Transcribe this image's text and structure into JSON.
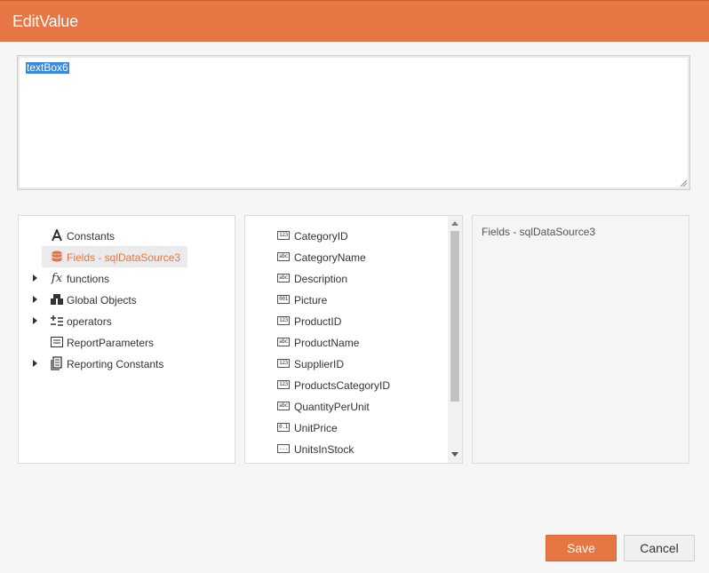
{
  "dialog": {
    "title": "EditValue"
  },
  "editor": {
    "value": "textBox6"
  },
  "tree": {
    "items": [
      {
        "label": "Constants",
        "icon": "letter-a-icon",
        "expandable": false,
        "selected": false
      },
      {
        "label": "Fields - sqlDataSource3",
        "icon": "database-icon",
        "expandable": false,
        "selected": true
      },
      {
        "label": "functions",
        "icon": "function-fx-icon",
        "expandable": true,
        "selected": false
      },
      {
        "label": "Global Objects",
        "icon": "objects-icon",
        "expandable": true,
        "selected": false
      },
      {
        "label": "operators",
        "icon": "operators-icon",
        "expandable": true,
        "selected": false
      },
      {
        "label": "ReportParameters",
        "icon": "parameters-icon",
        "expandable": false,
        "selected": false
      },
      {
        "label": "Reporting Constants",
        "icon": "document-icon",
        "expandable": true,
        "selected": false
      }
    ]
  },
  "fields": [
    {
      "label": "CategoryID",
      "type_glyph": "123"
    },
    {
      "label": "CategoryName",
      "type_glyph": "abc"
    },
    {
      "label": "Description",
      "type_glyph": "abc"
    },
    {
      "label": "Picture",
      "type_glyph": "001"
    },
    {
      "label": "ProductID",
      "type_glyph": "123"
    },
    {
      "label": "ProductName",
      "type_glyph": "abc"
    },
    {
      "label": "SupplierID",
      "type_glyph": "123"
    },
    {
      "label": "ProductsCategoryID",
      "type_glyph": "123"
    },
    {
      "label": "QuantityPerUnit",
      "type_glyph": "abc"
    },
    {
      "label": "UnitPrice",
      "type_glyph": "0.1"
    },
    {
      "label": "UnitsInStock",
      "type_glyph": "..."
    }
  ],
  "description": {
    "text": "Fields - sqlDataSource3"
  },
  "buttons": {
    "save": "Save",
    "cancel": "Cancel"
  },
  "colors": {
    "accent": "#e67643",
    "selection": "#3b88e0"
  }
}
